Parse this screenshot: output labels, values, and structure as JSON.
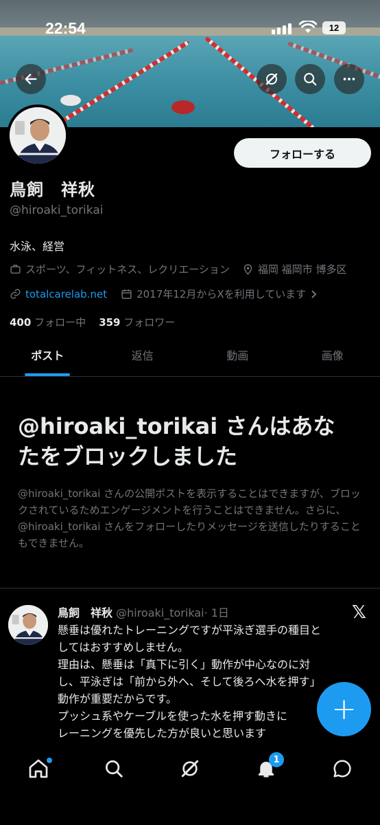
{
  "status_bar": {
    "time": "22:54",
    "battery": "12"
  },
  "header": {
    "back_icon": "arrow-left-icon",
    "grok_icon": "grok-icon",
    "search_icon": "search-icon",
    "more_icon": "more-icon"
  },
  "profile": {
    "name": "鳥飼　祥秋",
    "handle": "@hiroaki_torikai",
    "follow_label": "フォローする",
    "bio": "水泳、経営",
    "category": "スポーツ、フィットネス、レクリエーション",
    "location": "福岡 福岡市 博多区",
    "website": "totalcarelab.net",
    "joined": "2017年12月からXを利用しています",
    "following_count": "400",
    "following_label": "フォロー中",
    "followers_count": "359",
    "followers_label": "フォロワー"
  },
  "tabs": [
    {
      "label": "ポスト",
      "active": true
    },
    {
      "label": "返信",
      "active": false
    },
    {
      "label": "動画",
      "active": false
    },
    {
      "label": "画像",
      "active": false
    }
  ],
  "blocked": {
    "title": "@hiroaki_torikai さんはあなたをブロックしました",
    "description": "@hiroaki_torikai さんの公開ポストを表示することはできますが、ブロックされているためエンゲージメントを行うことはできません。さらに、@hiroaki_torikai さんをフォローしたりメッセージを送信したりすることもできません。"
  },
  "post": {
    "author": "鳥飼　祥秋",
    "handle": "@hiroaki_torikai",
    "time": "· 1日",
    "lines": [
      "懸垂は優れたトレーニングですが平泳ぎ選手の種目と",
      "してはおすすめしません。",
      "理由は、懸垂は「真下に引く」動作が中心なのに対",
      "し、平泳ぎは「前から外へ、そして後ろへ水を押す」",
      "動作が重要だからです。",
      "プッシュ系やケーブルを使った水を押す動きに",
      "レーニングを優先した方が良いと思います"
    ]
  },
  "fab": {
    "label": "+"
  },
  "bottom_nav": {
    "items": [
      "home-icon",
      "search-icon",
      "grok-icon",
      "notifications-icon",
      "messages-icon"
    ],
    "notification_badge": "1"
  },
  "colors": {
    "accent": "#1d9bf0",
    "background": "#000000",
    "muted": "#71767b"
  }
}
